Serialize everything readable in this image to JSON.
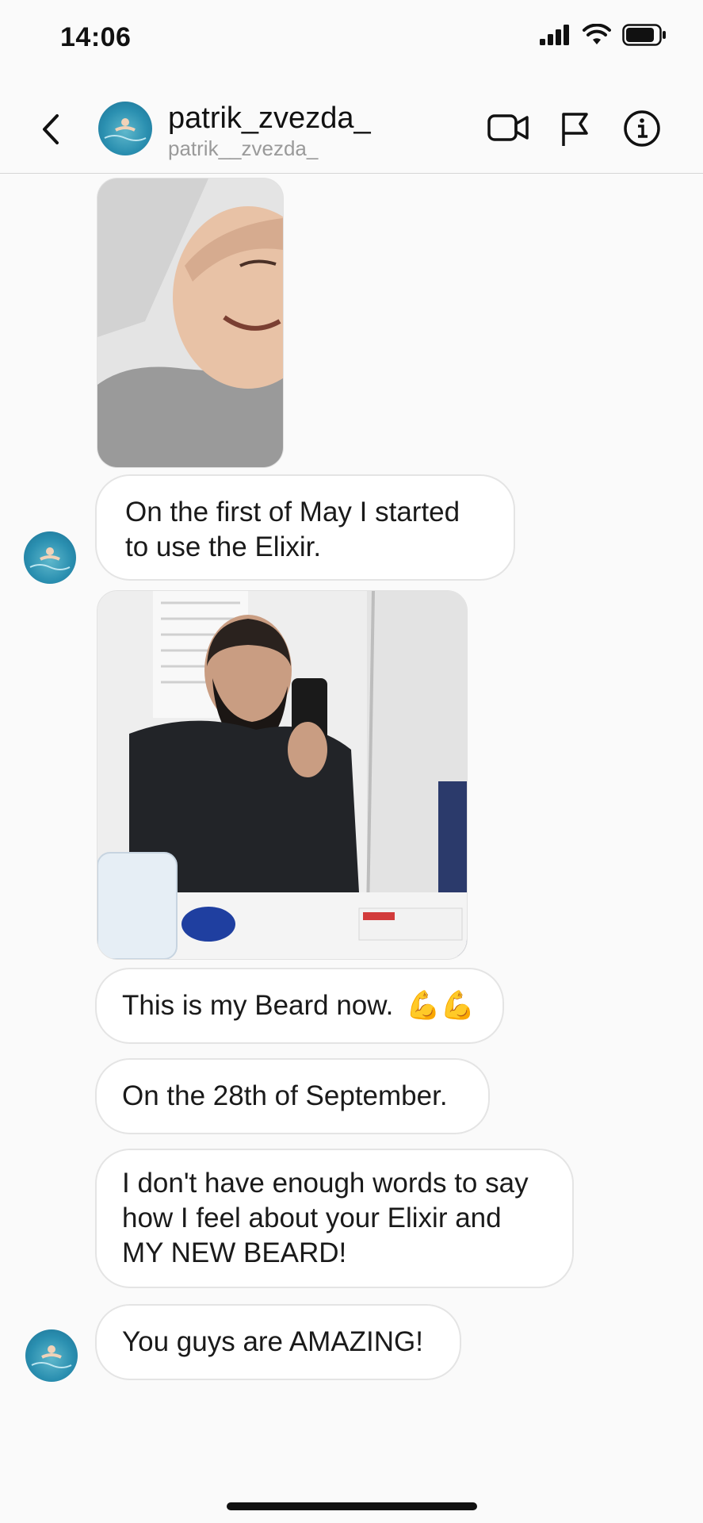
{
  "status_bar": {
    "time": "14:06"
  },
  "header": {
    "name": "patrik_zvezda_",
    "username": "patrik__zvezda_",
    "icons": [
      "back-chevron-icon",
      "video-call-icon",
      "flag-icon",
      "info-icon"
    ]
  },
  "messages": [
    {
      "type": "image",
      "description_icon": "selfie-photo"
    },
    {
      "type": "text",
      "text_line1": "On the first of May I started",
      "text_line2": "to use the Elixir."
    },
    {
      "type": "image",
      "description_icon": "mirror-selfie-photo"
    },
    {
      "type": "text",
      "text": "This is my Beard now.",
      "emoji": "💪💪"
    },
    {
      "type": "text",
      "text": "On the 28th of September."
    },
    {
      "type": "text",
      "text_line1": "I don't have enough words to say",
      "text_line2": "how I feel about your Elixir and",
      "text_line3": "MY NEW BEARD!"
    },
    {
      "type": "text",
      "text": "You guys are AMAZING!"
    }
  ],
  "colors": {
    "background": "#fafafa",
    "bubble_border": "#e4e4e4",
    "avatar": "#2a8fb0"
  }
}
